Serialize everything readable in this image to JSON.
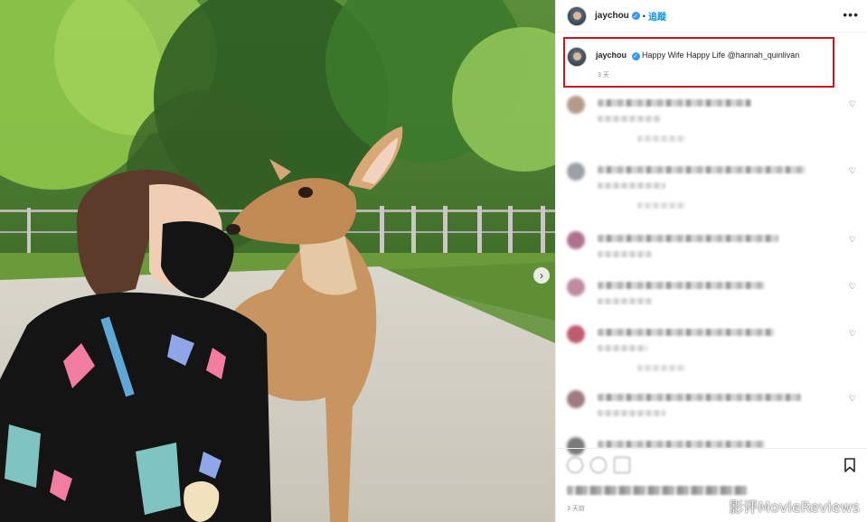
{
  "header": {
    "username": "jaychou",
    "separator": "•",
    "follow_label": "追蹤",
    "more_label": "•••"
  },
  "caption": {
    "username": "jaychou",
    "text": "Happy Wife Happy Life @hannah_quinlivan",
    "time": "3 天"
  },
  "comments": [
    {
      "avatar_color": "#b59a8a",
      "line_width": 170,
      "sub_width": 70,
      "reply": true
    },
    {
      "avatar_color": "#9aa0a6",
      "line_width": 230,
      "sub_width": 75,
      "reply": true
    },
    {
      "avatar_color": "#b07090",
      "line_width": 200,
      "sub_width": 60,
      "reply": false
    },
    {
      "avatar_color": "#c08aa0",
      "line_width": 185,
      "sub_width": 60,
      "reply": false
    },
    {
      "avatar_color": "#c05a70",
      "line_width": 195,
      "sub_width": 55,
      "reply": true
    },
    {
      "avatar_color": "#a07a80",
      "line_width": 225,
      "sub_width": 75,
      "reply": false
    },
    {
      "avatar_color": "#7a7a7a",
      "line_width": 185,
      "sub_width": 0,
      "reply": false
    }
  ],
  "footer": {
    "time": "3 天前"
  },
  "watermark": "影评MovieReviews",
  "colors": {
    "accent": "#0095f6",
    "highlight_box": "#c7161e",
    "verified": "#3897f0"
  }
}
